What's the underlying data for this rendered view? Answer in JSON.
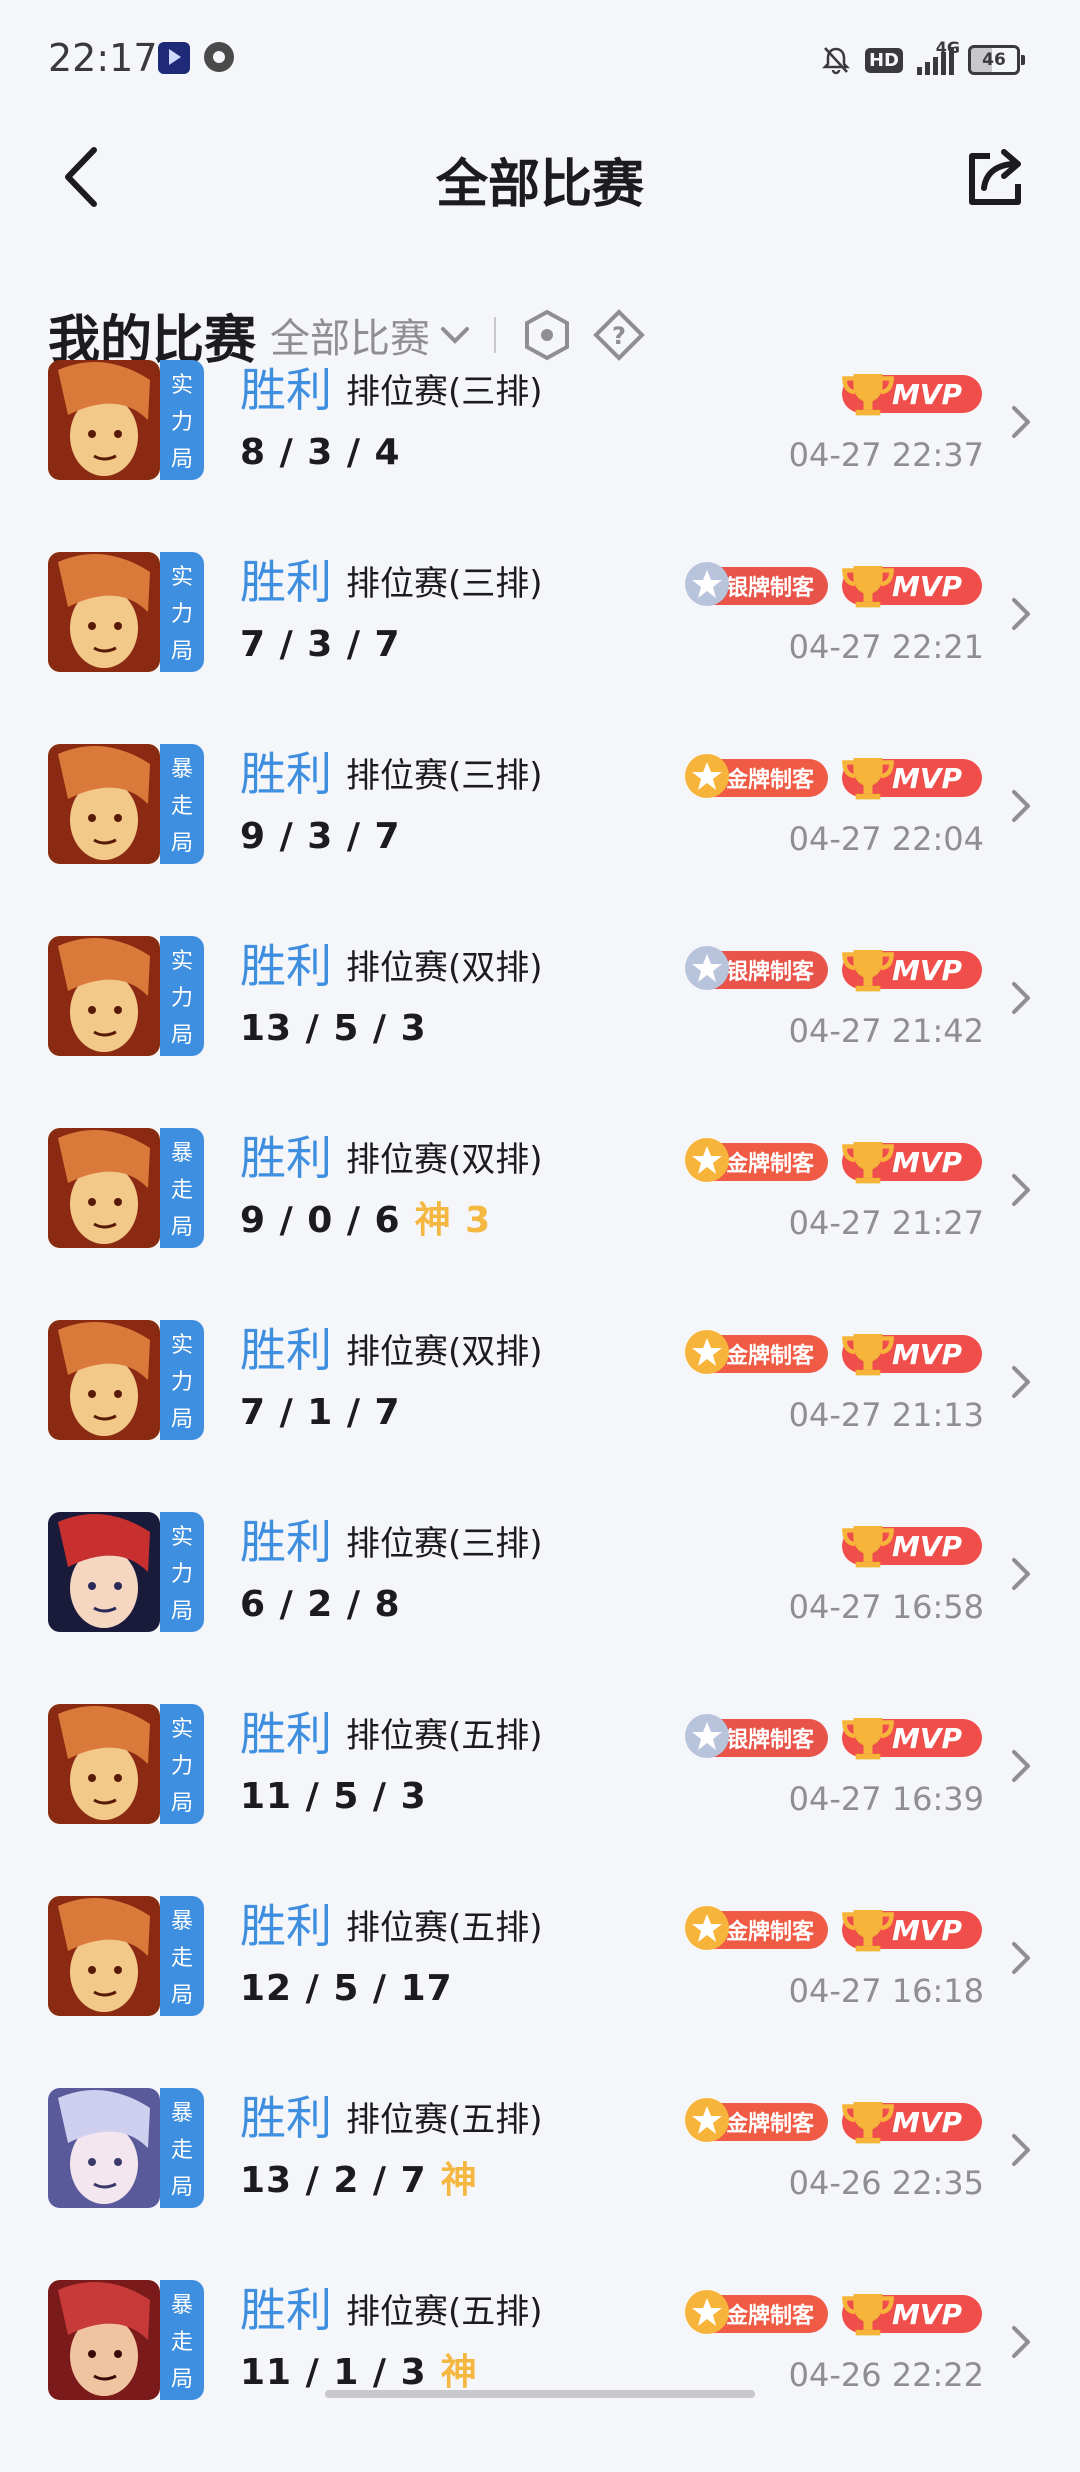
{
  "status_bar": {
    "time": "22:17",
    "network": "4G",
    "hd": "HD",
    "battery": "46"
  },
  "header": {
    "title": "全部比赛"
  },
  "filter": {
    "title": "我的比赛",
    "selected": "全部比赛"
  },
  "colors": {
    "accent": "#3f8fe0",
    "god": "#f4b73f",
    "mvp": "#ef4e4a",
    "gold_badge": "gold",
    "silver_badge": "silver"
  },
  "matches": [
    {
      "hero": "hero-a",
      "mode": [
        "实",
        "力",
        "局"
      ],
      "result": "胜利",
      "type": "排位赛(三排)",
      "kda": "8 / 3 / 4",
      "god": "",
      "badge": "",
      "mvp": "MVP",
      "time": "04-27 22:37"
    },
    {
      "hero": "hero-a",
      "mode": [
        "实",
        "力",
        "局"
      ],
      "result": "胜利",
      "type": "排位赛(三排)",
      "kda": "7 / 3 / 7",
      "god": "",
      "badge": "银牌制客",
      "badge_type": "silver",
      "mvp": "MVP",
      "time": "04-27 22:21"
    },
    {
      "hero": "hero-a",
      "mode": [
        "暴",
        "走",
        "局"
      ],
      "result": "胜利",
      "type": "排位赛(三排)",
      "kda": "9 / 3 / 7",
      "god": "",
      "badge": "金牌制客",
      "badge_type": "gold",
      "mvp": "MVP",
      "time": "04-27 22:04"
    },
    {
      "hero": "hero-a",
      "mode": [
        "实",
        "力",
        "局"
      ],
      "result": "胜利",
      "type": "排位赛(双排)",
      "kda": "13 / 5 / 3",
      "god": "",
      "badge": "银牌制客",
      "badge_type": "silver",
      "mvp": "MVP",
      "time": "04-27 21:42"
    },
    {
      "hero": "hero-a",
      "mode": [
        "暴",
        "走",
        "局"
      ],
      "result": "胜利",
      "type": "排位赛(双排)",
      "kda": "9 / 0 / 6",
      "god": "神 3",
      "badge": "金牌制客",
      "badge_type": "gold",
      "mvp": "MVP",
      "time": "04-27 21:27"
    },
    {
      "hero": "hero-a",
      "mode": [
        "实",
        "力",
        "局"
      ],
      "result": "胜利",
      "type": "排位赛(双排)",
      "kda": "7 / 1 / 7",
      "god": "",
      "badge": "金牌制客",
      "badge_type": "gold",
      "mvp": "MVP",
      "time": "04-27 21:13"
    },
    {
      "hero": "hero-b",
      "mode": [
        "实",
        "力",
        "局"
      ],
      "result": "胜利",
      "type": "排位赛(三排)",
      "kda": "6 / 2 / 8",
      "god": "",
      "badge": "",
      "mvp": "MVP",
      "time": "04-27 16:58"
    },
    {
      "hero": "hero-a",
      "mode": [
        "实",
        "力",
        "局"
      ],
      "result": "胜利",
      "type": "排位赛(五排)",
      "kda": "11 / 5 / 3",
      "god": "",
      "badge": "银牌制客",
      "badge_type": "silver",
      "mvp": "MVP",
      "time": "04-27 16:39"
    },
    {
      "hero": "hero-a",
      "mode": [
        "暴",
        "走",
        "局"
      ],
      "result": "胜利",
      "type": "排位赛(五排)",
      "kda": "12 / 5 / 17",
      "god": "",
      "badge": "金牌制客",
      "badge_type": "gold",
      "mvp": "MVP",
      "time": "04-27 16:18"
    },
    {
      "hero": "hero-c",
      "mode": [
        "暴",
        "走",
        "局"
      ],
      "result": "胜利",
      "type": "排位赛(五排)",
      "kda": "13 / 2 / 7",
      "god": "神",
      "badge": "金牌制客",
      "badge_type": "gold",
      "mvp": "MVP",
      "time": "04-26 22:35"
    },
    {
      "hero": "hero-d",
      "mode": [
        "暴",
        "走",
        "局"
      ],
      "result": "胜利",
      "type": "排位赛(五排)",
      "kda": "11 / 1 / 3",
      "god": "神",
      "badge": "金牌制客",
      "badge_type": "gold",
      "mvp": "MVP",
      "time": "04-26 22:22"
    }
  ]
}
